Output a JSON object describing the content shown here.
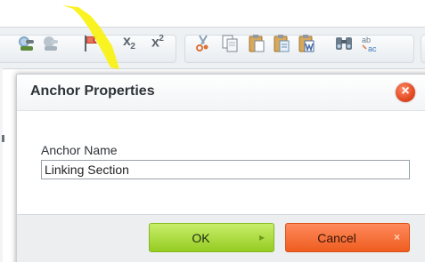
{
  "toolbar": {
    "buttons": [
      {
        "name": "link-icon"
      },
      {
        "name": "unlink-icon"
      },
      {
        "name": "anchor-flag-icon"
      },
      {
        "name": "subscript-icon",
        "text": "x",
        "script": "2"
      },
      {
        "name": "superscript-icon",
        "text": "x",
        "script": "2"
      },
      {
        "name": "cut-icon"
      },
      {
        "name": "copy-icon"
      },
      {
        "name": "paste-icon"
      },
      {
        "name": "paste-text-icon"
      },
      {
        "name": "paste-word-icon"
      },
      {
        "name": "find-icon"
      },
      {
        "name": "replace-icon"
      }
    ]
  },
  "annotation": {
    "color": "#f8f20f"
  },
  "dialog": {
    "title": "Anchor Properties",
    "close_icon": "close-icon",
    "field_label": "Anchor Name",
    "field_value": "Linking Section",
    "ok_label": "OK",
    "ok_icon": "▸",
    "cancel_label": "Cancel",
    "cancel_icon": "×",
    "ok_color": "#a9d83a",
    "cancel_color": "#f46a2c"
  }
}
